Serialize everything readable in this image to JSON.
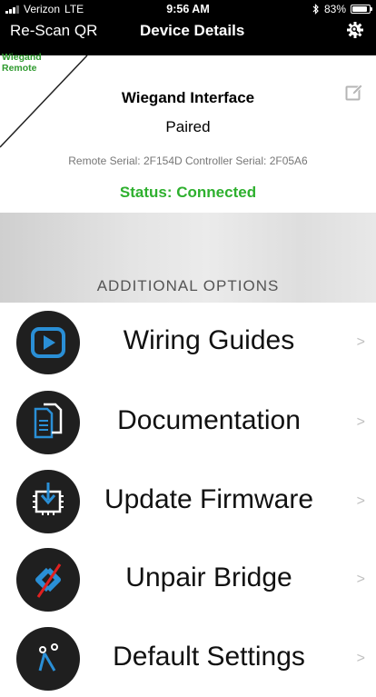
{
  "status_bar": {
    "carrier": "Verizon",
    "network": "LTE",
    "time": "9:56 AM",
    "battery": "83%",
    "battery_level": 0.83
  },
  "nav": {
    "back_label": "Re-Scan QR",
    "title": "Device Details"
  },
  "device": {
    "corner_label_line1": "Wiegand",
    "corner_label_line2": "Remote",
    "title": "Wiegand Interface",
    "pair_state": "Paired",
    "serials": "Remote Serial: 2F154D  Controller Serial: 2F05A6",
    "status": "Status: Connected"
  },
  "colors": {
    "accent_green": "#2eb02e",
    "icon_blue": "#2a8fd6",
    "icon_red": "#e02020",
    "icon_bg": "#1f1f1f"
  },
  "options": {
    "heading": "ADDITIONAL OPTIONS",
    "items": [
      {
        "label": "Wiring Guides",
        "icon": "play-icon"
      },
      {
        "label": "Documentation",
        "icon": "document-icon"
      },
      {
        "label": "Update Firmware",
        "icon": "firmware-chip-icon"
      },
      {
        "label": "Unpair Bridge",
        "icon": "unpair-link-icon"
      },
      {
        "label": "Default Settings",
        "icon": "settings-toggle-icon"
      }
    ]
  }
}
